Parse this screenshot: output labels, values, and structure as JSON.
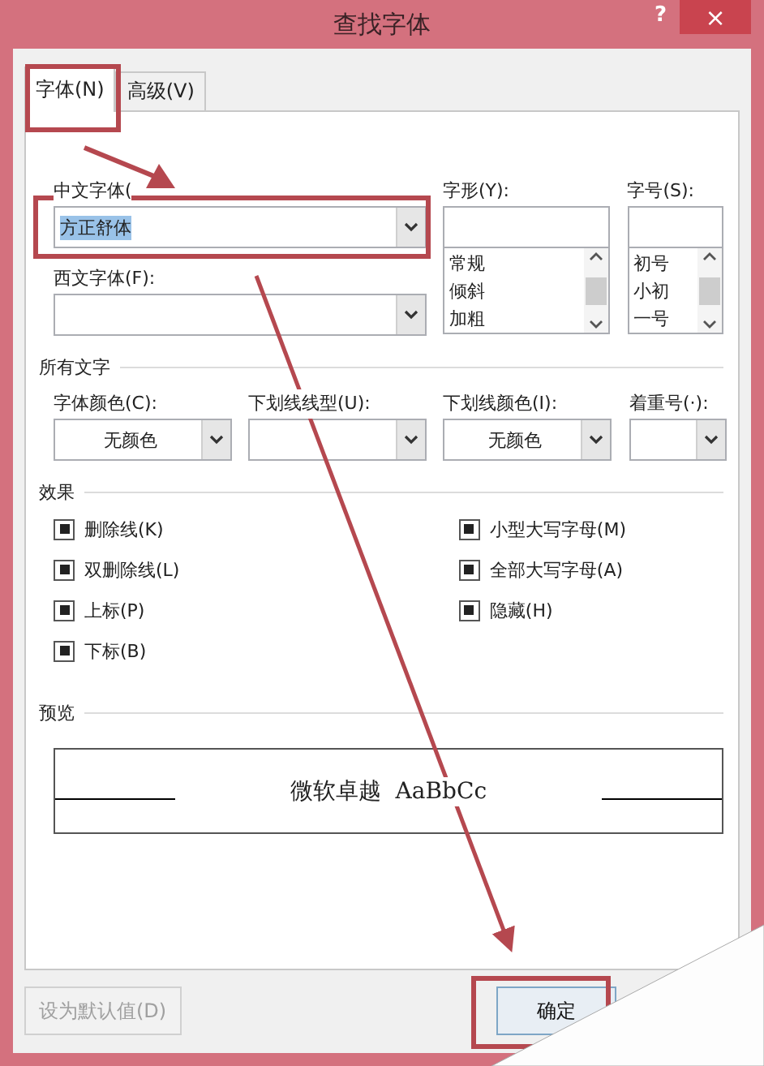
{
  "window": {
    "title": "查找字体",
    "help": "?",
    "close": "×"
  },
  "tabs": [
    {
      "label": "字体(N)",
      "selected": true
    },
    {
      "label": "高级(V)",
      "selected": false
    }
  ],
  "font": {
    "chinese_font": {
      "label": "中文字体(",
      "value": "方正舒体",
      "text_selected": true
    },
    "western_font": {
      "label": "西文字体(F):"
    },
    "style": {
      "label": "字形(Y):",
      "options": [
        "常规",
        "倾斜",
        "加粗"
      ]
    },
    "size": {
      "label": "字号(S):",
      "options": [
        "初号",
        "小初",
        "一号"
      ]
    }
  },
  "all_text": {
    "heading": "所有文字",
    "fields": [
      {
        "label": "字体颜色(C):",
        "value": "无颜色"
      },
      {
        "label": "下划线线型(U):"
      },
      {
        "label": "下划线颜色(I):",
        "value": "无颜色"
      },
      {
        "label": "着重号(·):"
      }
    ]
  },
  "effects": {
    "heading": "效果",
    "left": [
      {
        "label": "删除线(K)",
        "indeterminate": true
      },
      {
        "label": "双删除线(L)",
        "indeterminate": true
      },
      {
        "label": "上标(P)",
        "indeterminate": true
      },
      {
        "label": "下标(B)",
        "indeterminate": true
      }
    ],
    "right": [
      {
        "label": "小型大写字母(M)",
        "indeterminate": true
      },
      {
        "label": "全部大写字母(A)",
        "indeterminate": true
      },
      {
        "label": "隐藏(H)",
        "indeterminate": true
      }
    ]
  },
  "preview": {
    "heading": "预览",
    "sample": "微软卓越  AaBbCc"
  },
  "buttons": [
    {
      "label": "设为默认值(D)",
      "disabled": true
    },
    {
      "label": "确定",
      "disabled": false
    }
  ]
}
